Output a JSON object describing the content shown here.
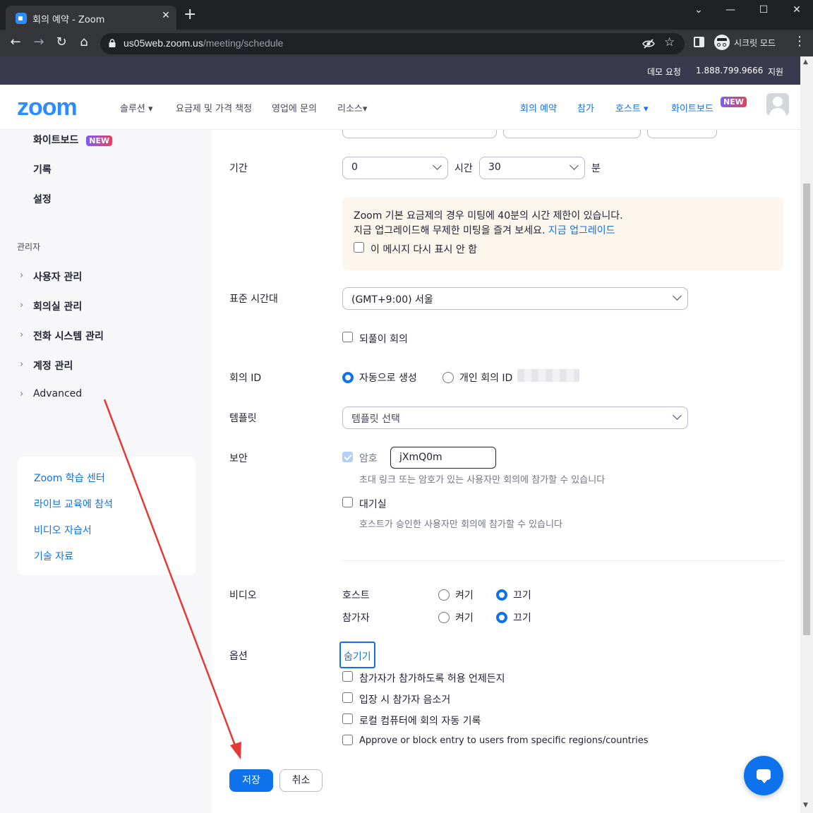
{
  "browser": {
    "tab_title": "회의 예약 - Zoom",
    "tab_close": "✕",
    "new_tab": "+",
    "url_host": "us05web.zoom.us",
    "url_path": "/meeting/schedule",
    "incognito_label": "시크릿 모드",
    "icons": [
      "back-icon",
      "forward-icon",
      "reload-icon",
      "home-icon",
      "lock-icon",
      "eye-off-icon",
      "star-icon",
      "side-panel-icon",
      "incognito-icon",
      "kebab-menu-icon"
    ]
  },
  "topstrip": {
    "demo": "데모 요청",
    "phone": "1.888.799.9666",
    "support": "지원"
  },
  "nav": {
    "logo": "zoom",
    "solutions": "솔루션",
    "pricing": "요금제 및 가격 책정",
    "sales": "영업에 문의",
    "resources": "리소스",
    "schedule": "회의 예약",
    "join": "참가",
    "host": "호스트",
    "whiteboard": "화이트보드",
    "new_badge": "NEW"
  },
  "sidebar": {
    "whiteboard": "화이트보드",
    "new_badge": "NEW",
    "recordings": "기록",
    "settings": "설정",
    "admin_section": "관리자",
    "admin_items": [
      "사용자 관리",
      "회의실 관리",
      "전화 시스템 관리",
      "계정 관리",
      "Advanced"
    ],
    "learn_links": [
      "Zoom 학습 센터",
      "라이브 교육에 참석",
      "비디오 자습서",
      "기술 자료"
    ]
  },
  "form": {
    "duration_label": "기간",
    "duration_hours": "0",
    "hours_unit": "시간",
    "duration_minutes": "30",
    "minutes_unit": "분",
    "notice_line1": "Zoom 기본 요금제의 경우 미팅에 40분의 시간 제한이 있습니다.",
    "notice_line2": "지금 업그레이드해 무제한 미팅을 즐겨 보세요.",
    "notice_link": "지금 업그레이드",
    "notice_dismiss": "이 메시지 다시 표시 안 함",
    "timezone_label": "표준 시간대",
    "timezone_value": "(GMT+9:00) 서울",
    "recurring": "되풀이 회의",
    "meeting_id_label": "회의 ID",
    "meeting_id_auto": "자동으로 생성",
    "meeting_id_personal": "개인 회의 ID",
    "template_label": "템플릿",
    "template_placeholder": "템플릿 선택",
    "security_label": "보안",
    "passcode_label": "암호",
    "passcode_value": "jXmQ0m",
    "passcode_hint": "초대 링크 또는 암호가 있는 사용자만 회의에 참가할 수 있습니다",
    "waiting_room": "대기실",
    "waiting_room_hint": "호스트가 승인한 사용자만 회의에 참가할 수 있습니다",
    "video_label": "비디오",
    "video_host": "호스트",
    "video_participant": "참가자",
    "video_on": "켜기",
    "video_off": "끄기",
    "options_label": "옵션",
    "options_hide": "숨기기",
    "option_items": [
      "참가자가 참가하도록 허용 언제든지",
      "입장 시 참가자 음소거",
      "로컬 컴퓨터에 회의 자동 기록",
      "Approve or block entry to users from specific regions/countries"
    ],
    "save": "저장",
    "cancel": "취소"
  },
  "colors": {
    "brand_blue": "#0e72ed",
    "zoom_logo": "#2d8cff",
    "annotation_arrow": "#e53935"
  }
}
